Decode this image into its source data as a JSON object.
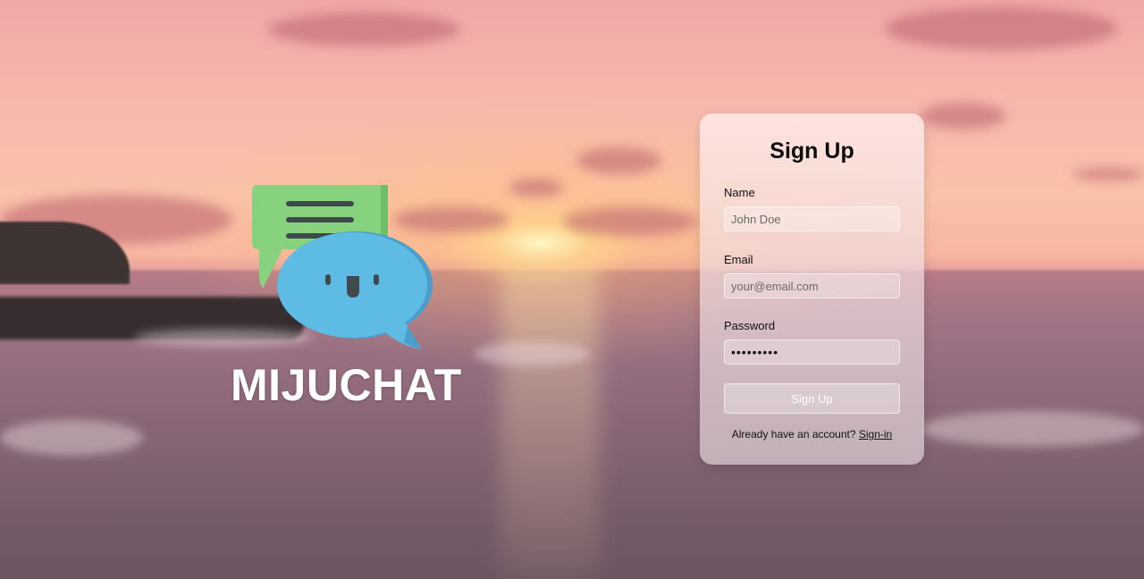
{
  "brand": {
    "name": "MIJUCHAT",
    "logo_icon": "chat-bubbles-icon"
  },
  "form": {
    "title": "Sign Up",
    "name": {
      "label": "Name",
      "placeholder": "John Doe"
    },
    "email": {
      "label": "Email",
      "placeholder": "your@email.com"
    },
    "password": {
      "label": "Password",
      "value": "•••••••••"
    },
    "submit_label": "Sign Up",
    "footer_text": "Already have an account? ",
    "footer_link": "Sign-in"
  },
  "colors": {
    "bubble_green": "#86d27e",
    "bubble_blue": "#5ebbe3",
    "card_bg": "#f0dcde",
    "button_text": "#ffffff"
  }
}
